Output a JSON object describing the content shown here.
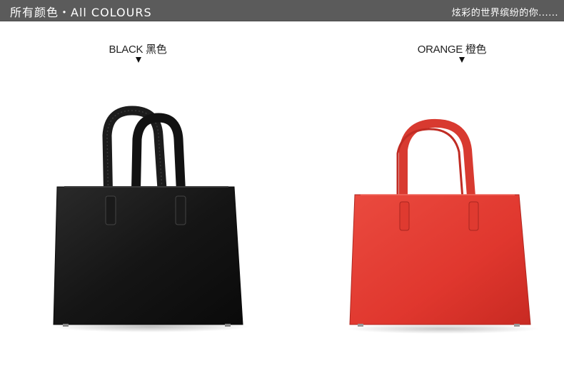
{
  "header": {
    "title": "所有颜色・All COLOURS",
    "slogan": "炫彩的世界缤纷的你......"
  },
  "variants": [
    {
      "label": "BLACK 黑色",
      "color": "#161616"
    },
    {
      "label": "ORANGE 橙色",
      "color": "#e23a30"
    }
  ],
  "colors": {
    "header_bg": "#5b5b5b",
    "header_text": "#ffffff",
    "background": "#ffffff"
  }
}
